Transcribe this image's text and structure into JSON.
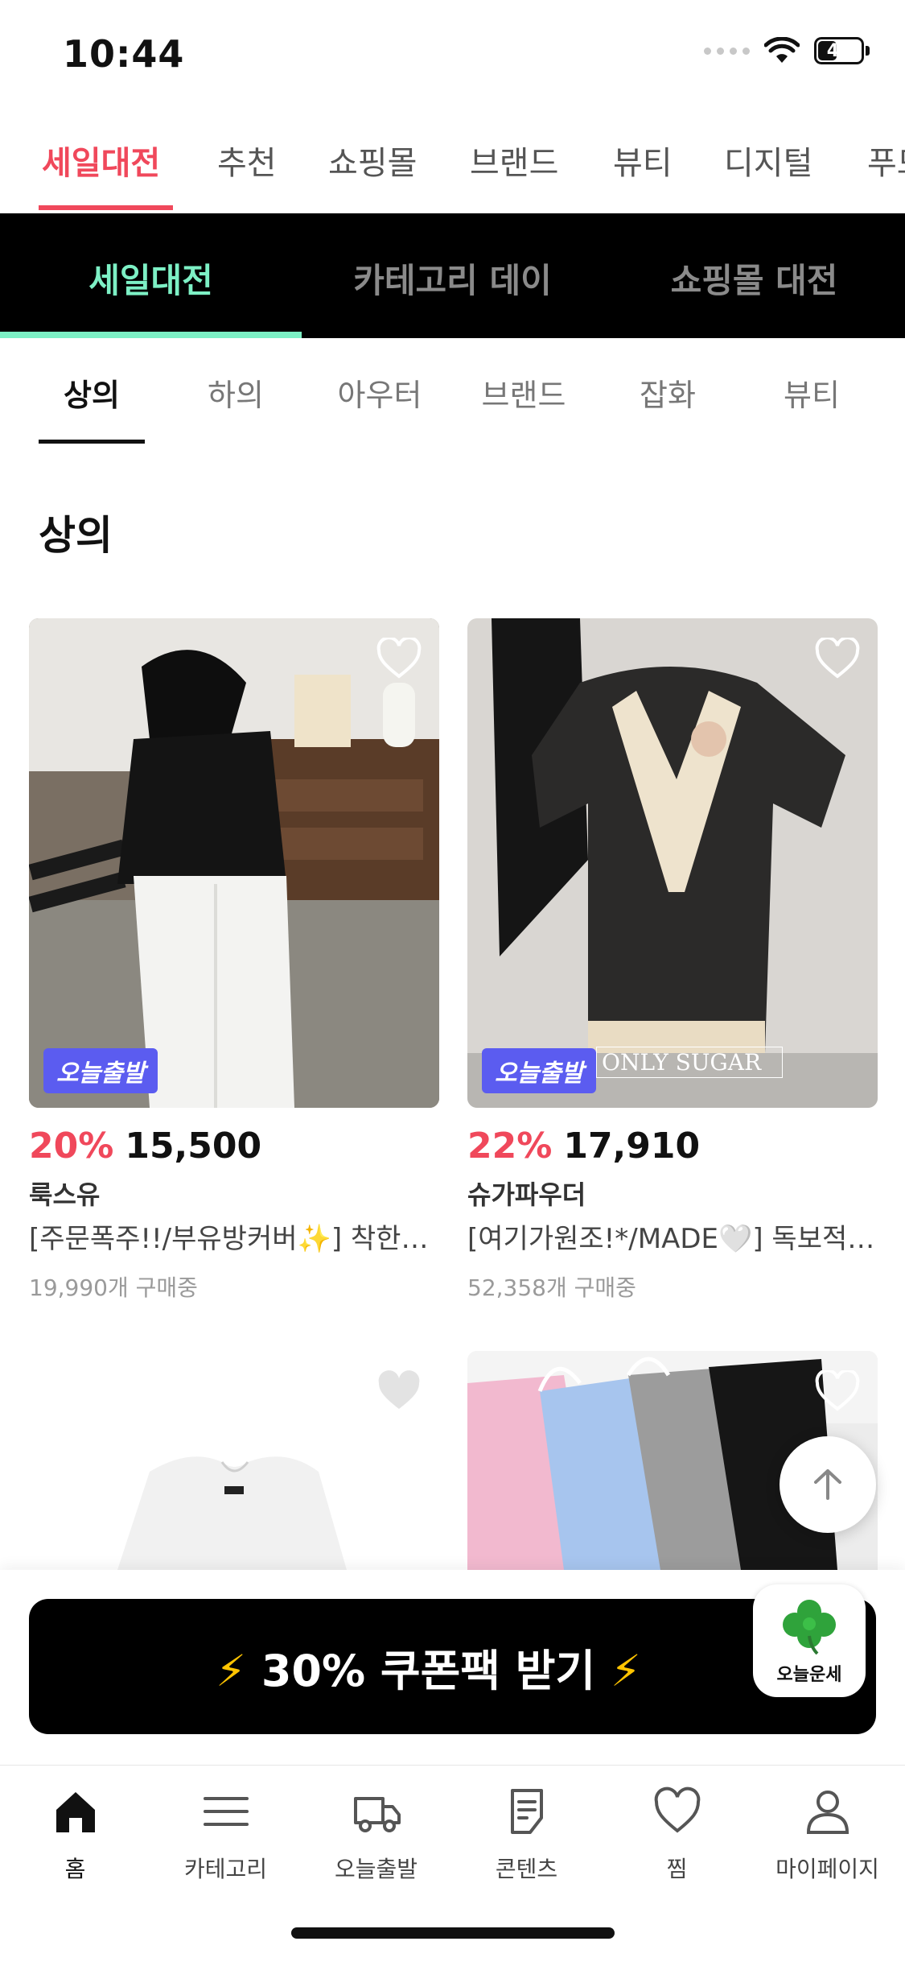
{
  "status_bar": {
    "time": "10:44",
    "battery": "44",
    "battery_level": 0.44
  },
  "top_nav": {
    "tabs": [
      "세일대전",
      "추천",
      "쇼핑몰",
      "브랜드",
      "뷰티",
      "디지털",
      "푸드"
    ]
  },
  "banner": {
    "tabs": [
      "세일대전",
      "카테고리 데이",
      "쇼핑몰 대전"
    ]
  },
  "category_tabs": [
    "상의",
    "하의",
    "아우터",
    "브랜드",
    "잡화",
    "뷰티"
  ],
  "section_title": "상의",
  "products": [
    {
      "badge": "오늘출발",
      "discount": "20%",
      "price": "15,500",
      "shop": "룩스유",
      "title": "[주문폭주!!/부유방커버✨] 착한가격 플리츠 블라우스",
      "buyers": "19,990개 구매중"
    },
    {
      "badge": "오늘출발",
      "discount": "22%",
      "price": "17,910",
      "shop": "슈가파우더",
      "title": "[여기가원조!*/MADE🤍] 독보적인 카라 가디건",
      "buyers": "52,358개 구매중",
      "image_text": "ONLY SUGAR"
    }
  ],
  "coupon": {
    "label": "30% 쿠폰팩 받기",
    "bolt": "⚡",
    "fortune_label": "오늘운세"
  },
  "bottom_nav": [
    "홈",
    "카테고리",
    "오늘출발",
    "콘텐츠",
    "찜",
    "마이페이지"
  ],
  "colors": {
    "accent": "#f0485b",
    "mint": "#7df0c5",
    "badge": "#5b5cf0",
    "bolt": "#ffc400"
  }
}
